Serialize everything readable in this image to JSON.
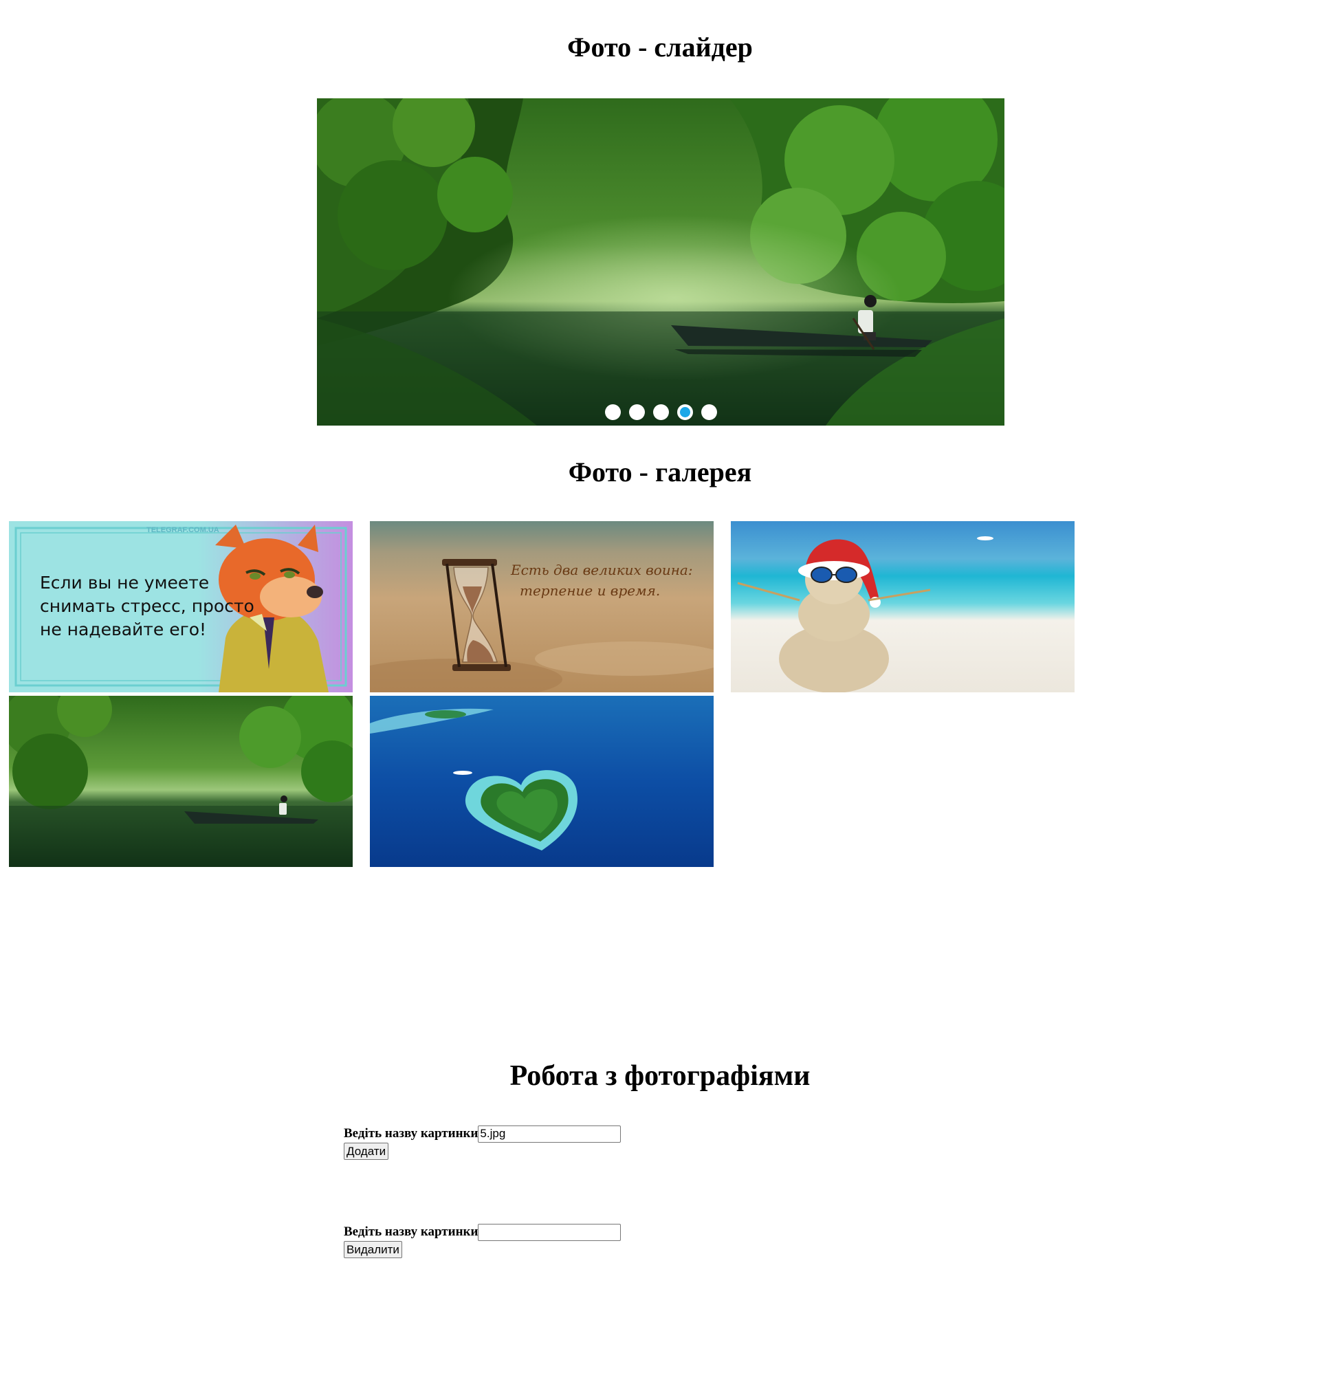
{
  "slider": {
    "title": "Фото - слайдер",
    "dots_count": 5,
    "active_dot_index": 3,
    "dot_color": "#ffffff",
    "active_dot_color": "#1aa7e8"
  },
  "gallery": {
    "title": "Фото - галерея",
    "images": [
      {
        "id": "fox",
        "caption_lines": [
          "Если вы не умеете",
          "снимать стресс, просто",
          "не надевайте его!"
        ],
        "watermark": "TELEGRAF.COM.UA"
      },
      {
        "id": "hourglass",
        "caption_lines": [
          "Есть два великих воина:",
          "терпение и время."
        ]
      },
      {
        "id": "sand-snowman"
      },
      {
        "id": "forest-lake-boat"
      },
      {
        "id": "heart-island"
      }
    ]
  },
  "work": {
    "title": "Робота з фотографіями",
    "add_form": {
      "label": "Ведіть назву картинки",
      "value": "5.jpg",
      "button": "Додати"
    },
    "delete_form": {
      "label": "Ведіть назву картинки",
      "value": "",
      "button": "Видалити"
    }
  }
}
